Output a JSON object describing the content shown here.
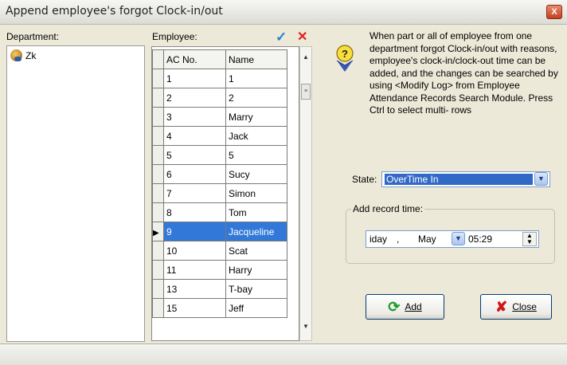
{
  "window": {
    "title": "Append employee's forgot Clock-in/out",
    "close_glyph": "X"
  },
  "department": {
    "label": "Department:",
    "items": [
      {
        "name": "Zk",
        "icon": "department-icon"
      }
    ]
  },
  "employee": {
    "label": "Employee:",
    "check_all_icon": "checkmark-icon",
    "clear_icon": "x-icon",
    "columns": [
      "AC No.",
      "Name"
    ],
    "rows": [
      {
        "ac": "1",
        "name": "1"
      },
      {
        "ac": "2",
        "name": "2"
      },
      {
        "ac": "3",
        "name": "Marry"
      },
      {
        "ac": "4",
        "name": "Jack"
      },
      {
        "ac": "5",
        "name": "5"
      },
      {
        "ac": "6",
        "name": "Sucy"
      },
      {
        "ac": "7",
        "name": "Simon"
      },
      {
        "ac": "8",
        "name": "Tom"
      },
      {
        "ac": "9",
        "name": "Jacqueline",
        "selected": true
      },
      {
        "ac": "10",
        "name": "Scat"
      },
      {
        "ac": "11",
        "name": "Harry"
      },
      {
        "ac": "13",
        "name": "T-bay"
      },
      {
        "ac": "15",
        "name": "Jeff"
      }
    ]
  },
  "info": {
    "icon": "info-bulb-icon",
    "text": "When part or all of employee from one department forgot Clock-in/out with reasons, employee's clock-in/clock-out time can be added, and the changes can be searched by using <Modify Log> from Employee Attendance Records Search Module. Press Ctrl to select multi- rows"
  },
  "state": {
    "label": "State:",
    "value": "OverTime In"
  },
  "add_record_time": {
    "label": "Add record time:",
    "date_day": "iday",
    "date_sep": ",",
    "date_month": "May",
    "time": "05:29"
  },
  "buttons": {
    "add": "Add",
    "close": "Close"
  },
  "colors": {
    "selection": "#3178d8",
    "state_highlight": "#3169c6",
    "close_red": "#d01818",
    "check_blue": "#2a7fd6"
  }
}
